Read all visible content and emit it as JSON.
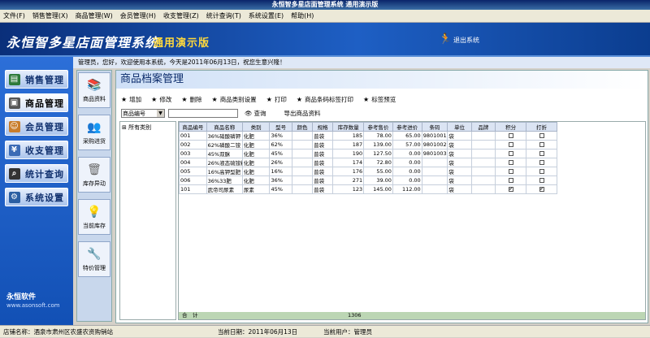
{
  "window_title": "永恒智多星店面管理系统 通用演示版",
  "menu": [
    "文件(F)",
    "销售管理(X)",
    "商品管理(W)",
    "会员管理(H)",
    "收支管理(Z)",
    "统计查询(T)",
    "系统设置(E)",
    "帮助(H)"
  ],
  "banner": {
    "brand": "永恒智多星店面管理系统",
    "edition": "通用演示版",
    "logout": "退出系统"
  },
  "left_nav": [
    "销售管理",
    "商品管理",
    "会员管理",
    "收支管理",
    "统计查询",
    "系统设置"
  ],
  "company": {
    "name": "永恒软件",
    "url": "www.asonsoft.com"
  },
  "greeting": "管理员，您好，欢迎使用本系统，今天是2011年06月13日，祝您生意兴隆！",
  "sub_nav": [
    "商品资料",
    "采购进货",
    "库存异动",
    "当前库存",
    "特价管理"
  ],
  "panel_title": "商品档案管理",
  "toolbar": [
    "增加",
    "修改",
    "删除",
    "商品类别设置",
    "打印",
    "商品条码标签打印",
    "标签预览"
  ],
  "search": {
    "field": "商品编号",
    "query_label": "查询",
    "export_label": "导出商品资料"
  },
  "tree": {
    "root": "所有类别"
  },
  "table": {
    "headers": [
      "商品编号",
      "商品名称",
      "类别",
      "型号",
      "颜色",
      "规格",
      "库存数量",
      "参考售价",
      "参考进价",
      "条码",
      "单位",
      "品牌",
      "积分",
      "打折"
    ],
    "rows": [
      [
        "001",
        "36%硝酸磷钾",
        "化肥",
        "36%",
        "",
        "普袋",
        "185",
        "78.00",
        "65.00",
        "9801001",
        "袋",
        "",
        "",
        ""
      ],
      [
        "002",
        "62%磷酸二铵",
        "化肥",
        "62%",
        "",
        "普袋",
        "187",
        "139.00",
        "57.00",
        "9801002",
        "袋",
        "",
        "",
        ""
      ],
      [
        "003",
        "45%双脒",
        "化肥",
        "45%",
        "",
        "普袋",
        "190",
        "127.50",
        "0.00",
        "9801003",
        "袋",
        "",
        "",
        ""
      ],
      [
        "004",
        "26%液态硫铵粉",
        "化肥",
        "26%",
        "",
        "普袋",
        "174",
        "72.80",
        "0.00",
        "",
        "袋",
        "",
        "",
        ""
      ],
      [
        "005",
        "16%高钾型肥",
        "化肥",
        "16%",
        "",
        "普袋",
        "176",
        "55.00",
        "0.00",
        "",
        "袋",
        "",
        "",
        ""
      ],
      [
        "006",
        "36%33肥",
        "化肥",
        "36%",
        "",
        "普袋",
        "271",
        "39.00",
        "0.00",
        "",
        "袋",
        "",
        "",
        ""
      ],
      [
        "101",
        "武帝司尿素",
        "尿素",
        "45%",
        "",
        "普袋",
        "123",
        "145.00",
        "112.00",
        "",
        "袋",
        "",
        "✔",
        "✔"
      ]
    ],
    "sum_label": "合　计",
    "sum_qty": "1306"
  },
  "status": {
    "store": "店铺名称：酒泉市肃州区农盛农资购销站",
    "date": "当前日期：2011年06月13日",
    "user": "当前用户：管理员"
  }
}
